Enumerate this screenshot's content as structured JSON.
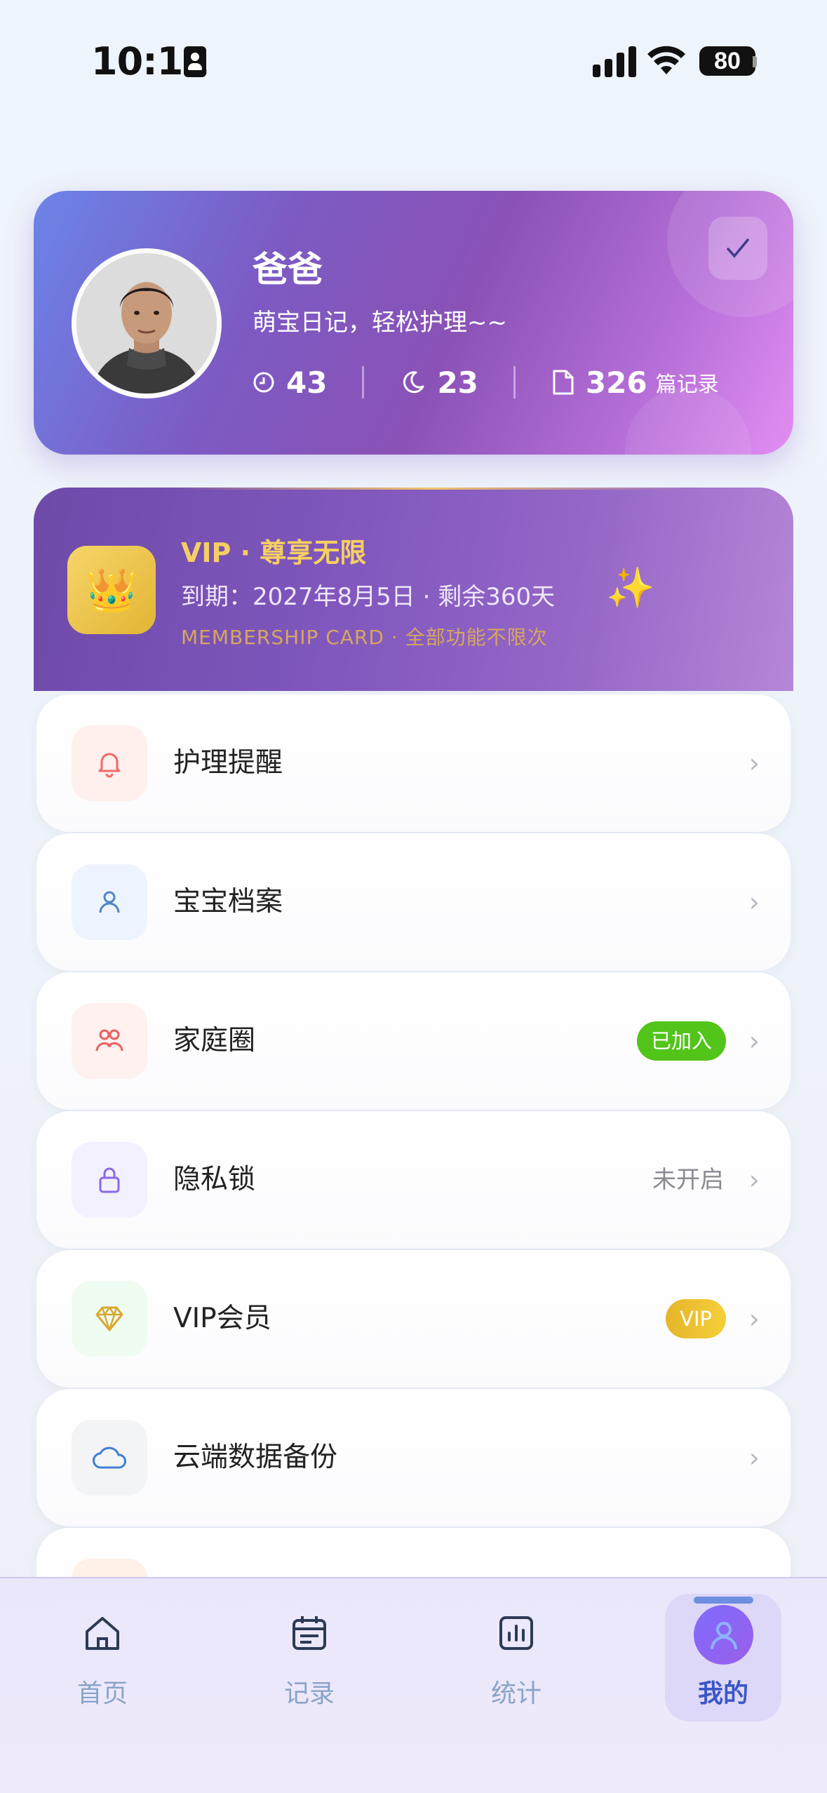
{
  "status_bar": {
    "time": "10:11",
    "battery": "80"
  },
  "profile": {
    "name": "爸爸",
    "bio": "萌宝日记，轻松护理~~",
    "stats": [
      {
        "icon": "clock-icon",
        "value": "43"
      },
      {
        "icon": "moon-icon",
        "value": "23"
      },
      {
        "icon": "document-icon",
        "value": "326",
        "unit": "篇记录"
      }
    ],
    "checkin_icon": "checkmark-icon"
  },
  "vip_card": {
    "icon": "crown-icon",
    "title": "VIP · 尊享无限",
    "expiry": "到期：2027年8月5日 · 剩余360天",
    "subtitle": "MEMBERSHIP CARD · 全部功能不限次",
    "accent": "#f5cf63"
  },
  "menu": [
    {
      "label": "护理提醒",
      "icon": "bell-icon"
    },
    {
      "label": "宝宝档案",
      "icon": "person-icon"
    },
    {
      "label": "家庭圈",
      "icon": "family-icon",
      "badge": "已加入",
      "badge_color": "#52c41a"
    },
    {
      "label": "隐私锁",
      "icon": "lock-icon",
      "right_text": "未开启"
    },
    {
      "label": "VIP会员",
      "icon": "diamond-icon",
      "badge": "VIP",
      "badge_color": "#f2c12e"
    },
    {
      "label": "云端数据备份",
      "icon": "cloud-icon"
    }
  ],
  "tabbar": {
    "tabs": [
      {
        "label": "首页",
        "icon": "home-icon"
      },
      {
        "label": "记录",
        "icon": "calendar-icon"
      },
      {
        "label": "统计",
        "icon": "chart-icon"
      },
      {
        "label": "我的",
        "icon": "user-icon",
        "active": true
      }
    ]
  }
}
